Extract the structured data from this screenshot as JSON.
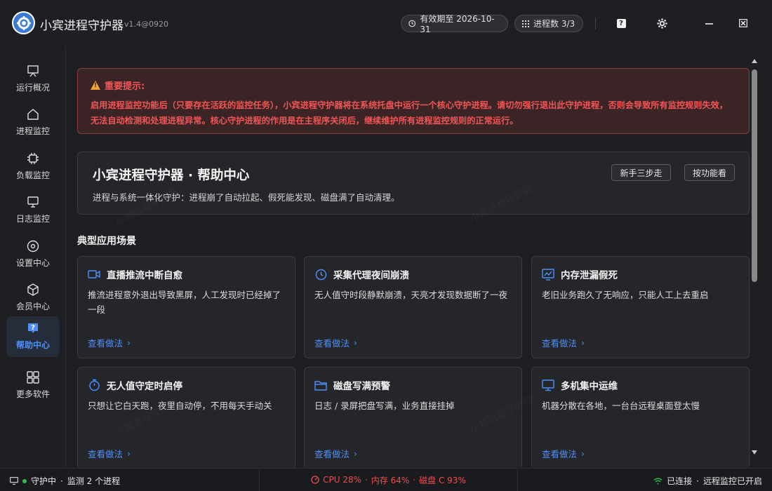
{
  "app": {
    "name": "小宾进程守护器",
    "version": "v1.4@0920"
  },
  "header": {
    "expiry": "有效期至 2026-10-31",
    "process_count": "进程数 3/3"
  },
  "sidebar": {
    "items": [
      {
        "label": "运行概况",
        "icon": "presentation-icon"
      },
      {
        "label": "进程监控",
        "icon": "home-icon"
      },
      {
        "label": "负载监控",
        "icon": "chip-icon"
      },
      {
        "label": "日志监控",
        "icon": "monitor-icon"
      },
      {
        "label": "设置中心",
        "icon": "settings-circle-icon"
      },
      {
        "label": "会员中心",
        "icon": "box-icon"
      },
      {
        "label": "帮助中心",
        "icon": "help-icon",
        "active": true
      },
      {
        "label": "更多软件",
        "icon": "grid-icon"
      }
    ]
  },
  "warning": {
    "title": "重要提示:",
    "body": "启用进程监控功能后（只要存在活跃的监控任务），小宾进程守护器将在系统托盘中运行一个核心守护进程。请切勿强行退出此守护进程，否则会导致所有监控规则失效，无法自动检测和处理进程异常。核心守护进程的作用是在主程序关闭后，继续维护所有进程监控规则的正常运行。"
  },
  "hero": {
    "title": "小宾进程守护器 · 帮助中心",
    "subtitle": "进程与系统一体化守护：进程崩了自动拉起、假死能发现、磁盘满了自动清理。",
    "btn_steps": "新手三步走",
    "btn_by_feature": "按功能看"
  },
  "scenarios": {
    "title": "典型应用场景",
    "link_label": "查看做法",
    "cards": [
      {
        "title": "直播推流中断自愈",
        "desc": "推流进程意外退出导致黑屏，人工发现时已经掉了一段",
        "icon": "video-icon"
      },
      {
        "title": "采集代理夜间崩溃",
        "desc": "无人值守时段静默崩溃，天亮才发现数据断了一夜",
        "icon": "clock-icon"
      },
      {
        "title": "内存泄漏假死",
        "desc": "老旧业务跑久了无响应，只能人工上去重启",
        "icon": "chart-icon"
      },
      {
        "title": "无人值守定时启停",
        "desc": "只想让它白天跑，夜里自动停，不用每天手动关",
        "icon": "stopwatch-icon"
      },
      {
        "title": "磁盘写满预警",
        "desc": "日志 / 录屏把盘写满，业务直接挂掉",
        "icon": "folder-icon"
      },
      {
        "title": "多机集中运维",
        "desc": "机器分散在各地，一台台远程桌面登太慢",
        "icon": "desktop-icon"
      }
    ]
  },
  "status": {
    "guard": "守护中",
    "monitoring": "监测 2 个进程",
    "cpu": "CPU 28%",
    "mem": "内存 64%",
    "disk": "磁盘 C 93%",
    "connected": "已连接",
    "remote": "远程监控已开启"
  },
  "colors": {
    "accent": "#4f8ff7",
    "danger": "#f25555",
    "ok": "#2fbf4a",
    "warn_icon": "#f2a23c"
  }
}
